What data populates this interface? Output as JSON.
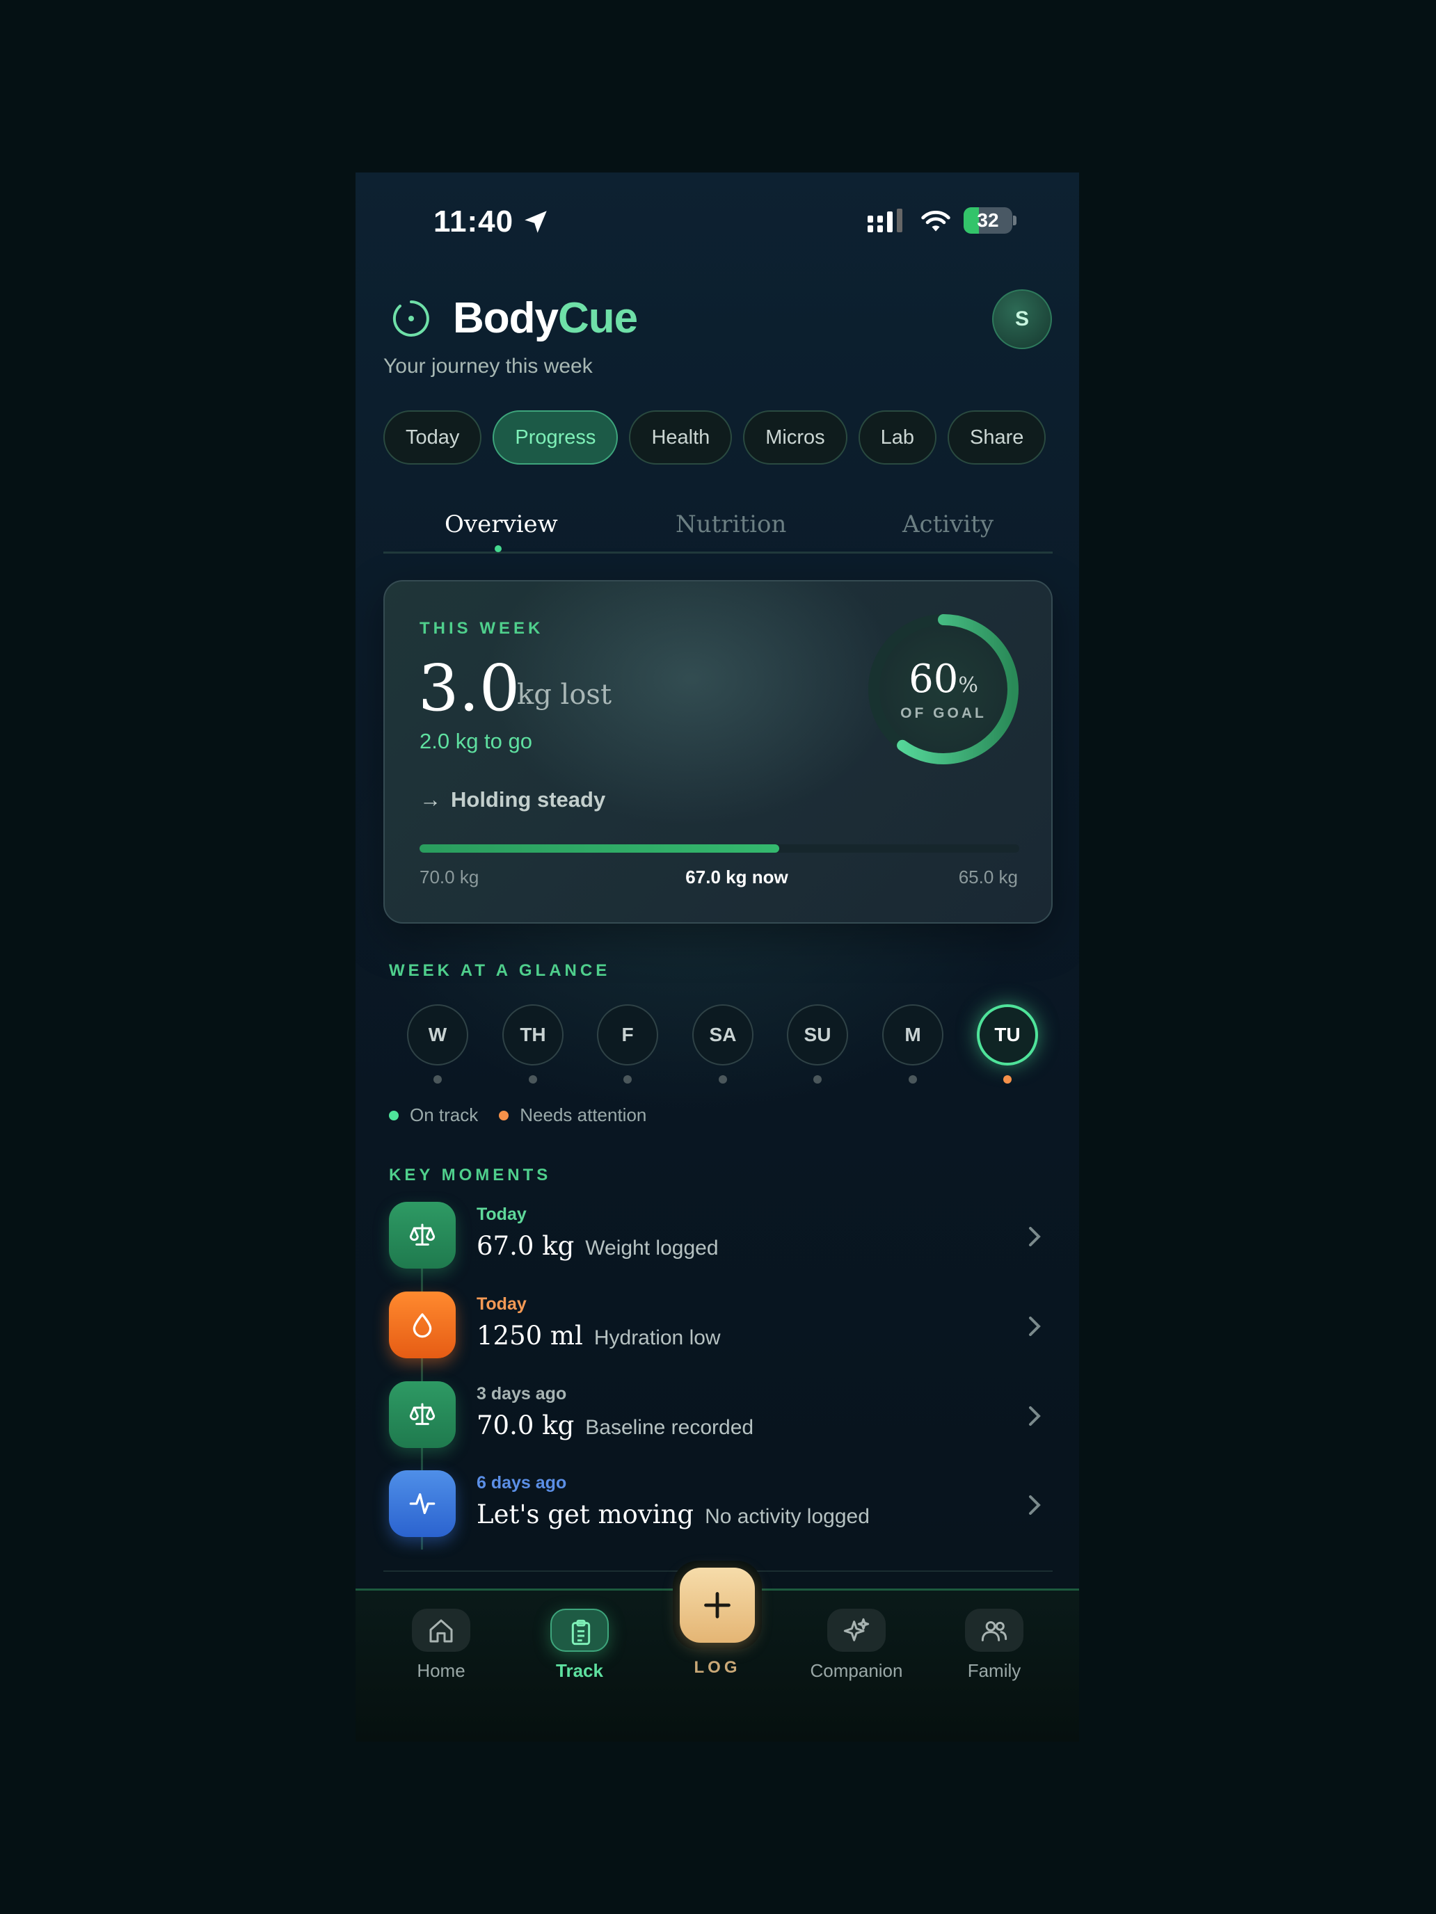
{
  "status_bar": {
    "time": "11:40",
    "battery": "32",
    "battery_level": 0.32
  },
  "header": {
    "brand_part1": "Body",
    "brand_part2": "Cue",
    "avatar_initial": "S",
    "subtitle": "Your journey this week"
  },
  "pills": [
    {
      "label": "Today",
      "active": false
    },
    {
      "label": "Progress",
      "active": true
    },
    {
      "label": "Health",
      "active": false
    },
    {
      "label": "Micros",
      "active": false
    },
    {
      "label": "Lab",
      "active": false
    },
    {
      "label": "Share",
      "active": false
    }
  ],
  "tabs": [
    {
      "label": "Overview",
      "active": true
    },
    {
      "label": "Nutrition",
      "active": false
    },
    {
      "label": "Activity",
      "active": false
    }
  ],
  "week_card": {
    "label": "THIS WEEK",
    "value": "3.0",
    "unit": "kg lost",
    "to_go": "2.0 kg to go",
    "trend_arrow": "→",
    "trend": "Holding steady",
    "goal_percent": 60,
    "goal_percent_text": "60",
    "percent_sign": "%",
    "goal_label": "OF GOAL",
    "progress_fraction": 0.6,
    "start_label": "70.0 kg",
    "now_label": "67.0 kg now",
    "end_label": "65.0 kg"
  },
  "week_glance": {
    "label": "WEEK AT A GLANCE",
    "days": [
      {
        "label": "W",
        "status": "neutral",
        "active": false
      },
      {
        "label": "TH",
        "status": "neutral",
        "active": false
      },
      {
        "label": "F",
        "status": "neutral",
        "active": false
      },
      {
        "label": "SA",
        "status": "neutral",
        "active": false
      },
      {
        "label": "SU",
        "status": "neutral",
        "active": false
      },
      {
        "label": "M",
        "status": "neutral",
        "active": false
      },
      {
        "label": "TU",
        "status": "attention",
        "active": true
      }
    ],
    "legend_on_track": "On track",
    "legend_attention": "Needs attention"
  },
  "key_moments": {
    "label": "KEY MOMENTS",
    "items": [
      {
        "when": "Today",
        "when_color": "#5fd99a",
        "value": "67.0 kg",
        "desc": "Weight logged",
        "icon": "scale-icon"
      },
      {
        "when": "Today",
        "when_color": "#f59a55",
        "value": "1250 ml",
        "desc": "Hydration low",
        "icon": "drop-icon"
      },
      {
        "when": "3 days ago",
        "when_color": "#a8b5b4",
        "value": "70.0 kg",
        "desc": "Baseline recorded",
        "icon": "scale-icon"
      },
      {
        "when": "6 days ago",
        "when_color": "#5b8fe6",
        "value": "Let's get moving",
        "desc": "No activity logged",
        "icon": "activity-icon"
      }
    ]
  },
  "nav": {
    "home": "Home",
    "track": "Track",
    "log": "LOG",
    "companion": "Companion",
    "family": "Family"
  },
  "colors": {
    "accent": "#4fe39a",
    "attention": "#f5914a",
    "fab": "#f0cb8e"
  }
}
